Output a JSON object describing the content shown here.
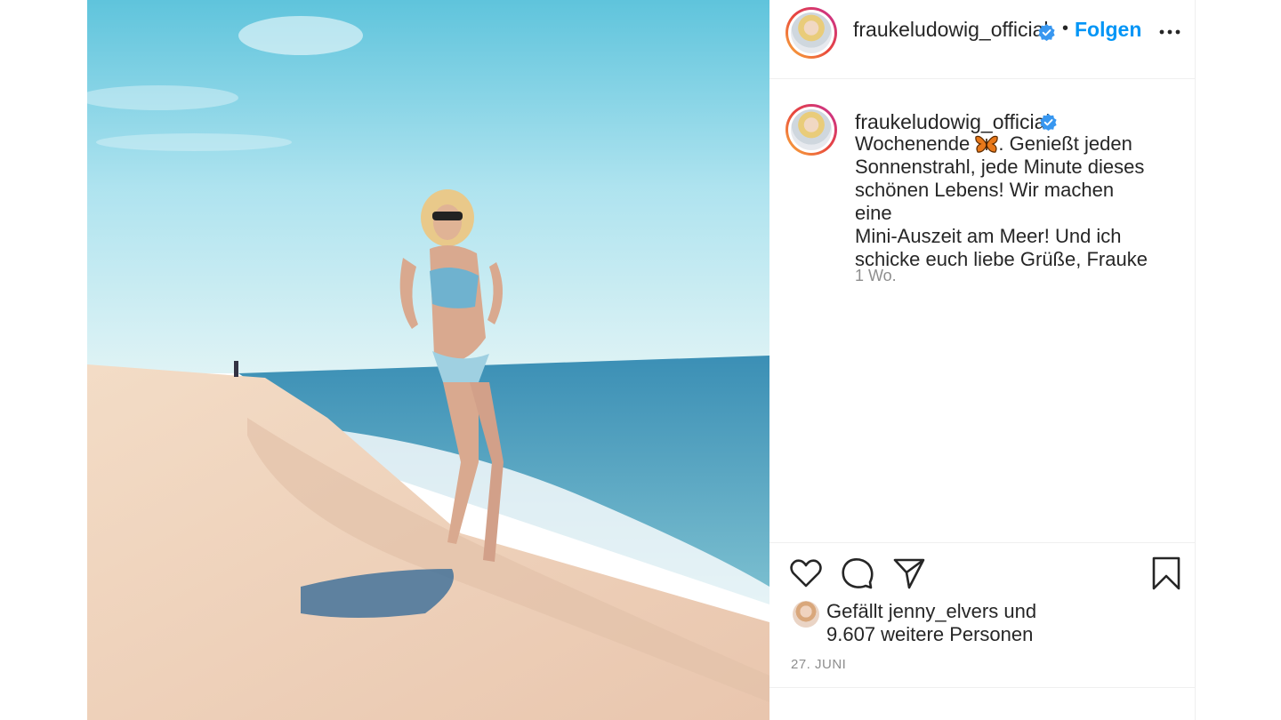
{
  "header": {
    "username": "fraukeludowig_official",
    "separator": "•",
    "follow_label": "Folgen",
    "verified_icon": "verified-badge-icon",
    "more_icon": "more-options-icon"
  },
  "caption": {
    "username": "fraukeludowig_official",
    "text_before_emoji": "Wochenende ",
    "emoji_icon": "butterfly-emoji-icon",
    "text_after_emoji": ". Genießt jeden\nSonnenstrahl, jede Minute dieses\nschönen Lebens! Wir machen eine\nMini-Auszeit am Meer! Und ich\nschicke euch liebe Grüße, Frauke",
    "time_ago": "1 Wo."
  },
  "actions": {
    "like_icon": "heart-icon",
    "comment_icon": "comment-icon",
    "share_icon": "share-icon",
    "save_icon": "bookmark-icon"
  },
  "likes": {
    "prefix": "Gefällt",
    "liker": "jenny_elvers",
    "conjunction": "und",
    "others": "9.607 weitere Personen"
  },
  "post_date": "27. JUNI",
  "colors": {
    "accent": "#0095f6",
    "verified": "#3897f0",
    "text": "#262626",
    "muted": "#8e8e8e"
  }
}
